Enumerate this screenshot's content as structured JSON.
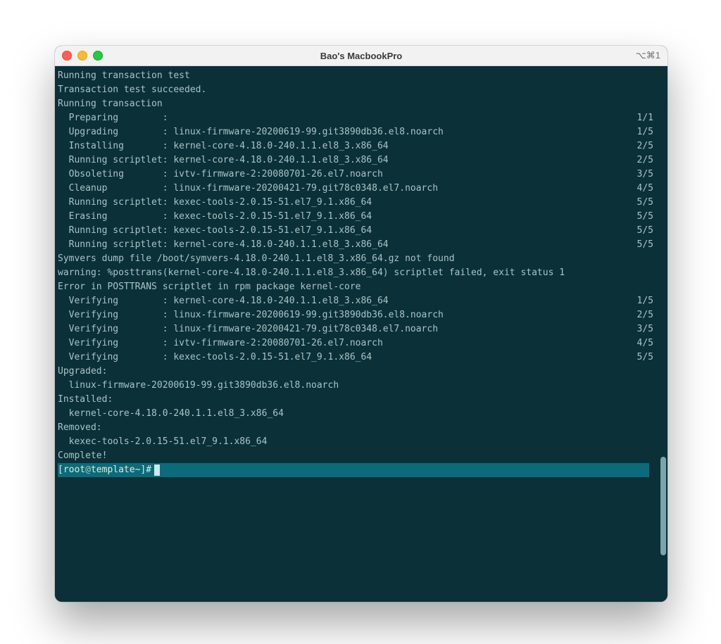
{
  "window": {
    "title": "Bao's MacbookPro",
    "shortcut": "⌥⌘1"
  },
  "terminal": {
    "header": [
      "Running transaction test",
      "Transaction test succeeded.",
      "Running transaction"
    ],
    "steps": [
      {
        "label": "Preparing",
        "pkg": "",
        "count": "1/1"
      },
      {
        "label": "Upgrading",
        "pkg": "linux-firmware-20200619-99.git3890db36.el8.noarch",
        "count": "1/5"
      },
      {
        "label": "Installing",
        "pkg": "kernel-core-4.18.0-240.1.1.el8_3.x86_64",
        "count": "2/5"
      },
      {
        "label": "Running scriptlet",
        "pkg": "kernel-core-4.18.0-240.1.1.el8_3.x86_64",
        "count": "2/5"
      },
      {
        "label": "Obsoleting",
        "pkg": "ivtv-firmware-2:20080701-26.el7.noarch",
        "count": "3/5"
      },
      {
        "label": "Cleanup",
        "pkg": "linux-firmware-20200421-79.git78c0348.el7.noarch",
        "count": "4/5"
      },
      {
        "label": "Running scriptlet",
        "pkg": "kexec-tools-2.0.15-51.el7_9.1.x86_64",
        "count": "5/5"
      },
      {
        "label": "Erasing",
        "pkg": "kexec-tools-2.0.15-51.el7_9.1.x86_64",
        "count": "5/5"
      },
      {
        "label": "Running scriptlet",
        "pkg": "kexec-tools-2.0.15-51.el7_9.1.x86_64",
        "count": "5/5"
      },
      {
        "label": "Running scriptlet",
        "pkg": "kernel-core-4.18.0-240.1.1.el8_3.x86_64",
        "count": "5/5"
      }
    ],
    "mid": [
      "Symvers dump file /boot/symvers-4.18.0-240.1.1.el8_3.x86_64.gz not found",
      "warning: %posttrans(kernel-core-4.18.0-240.1.1.el8_3.x86_64) scriptlet failed, exit status 1",
      "",
      "Error in POSTTRANS scriptlet in rpm package kernel-core"
    ],
    "verify": [
      {
        "pkg": "kernel-core-4.18.0-240.1.1.el8_3.x86_64",
        "count": "1/5"
      },
      {
        "pkg": "linux-firmware-20200619-99.git3890db36.el8.noarch",
        "count": "2/5"
      },
      {
        "pkg": "linux-firmware-20200421-79.git78c0348.el7.noarch",
        "count": "3/5"
      },
      {
        "pkg": "ivtv-firmware-2:20080701-26.el7.noarch",
        "count": "4/5"
      },
      {
        "pkg": "kexec-tools-2.0.15-51.el7_9.1.x86_64",
        "count": "5/5"
      }
    ],
    "verify_label": "Verifying",
    "sections": {
      "upgraded": {
        "title": "Upgraded:",
        "items": [
          "linux-firmware-20200619-99.git3890db36.el8.noarch"
        ]
      },
      "installed": {
        "title": "Installed:",
        "items": [
          "kernel-core-4.18.0-240.1.1.el8_3.x86_64"
        ]
      },
      "removed": {
        "title": "Removed:",
        "items": [
          "kexec-tools-2.0.15-51.el7_9.1.x86_64"
        ]
      }
    },
    "complete": "Complete!",
    "prompt": {
      "open": "[",
      "user": "root",
      "at": "@",
      "host": "template",
      "path": " ~",
      "close": "]",
      "sym": "#"
    }
  }
}
